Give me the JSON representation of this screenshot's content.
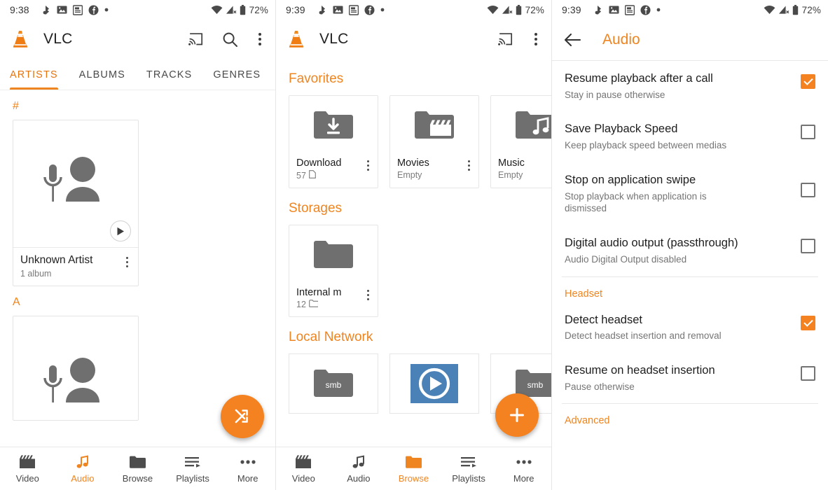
{
  "status_bar": {
    "time_panel1": "9:38",
    "time_panel2": "9:39",
    "time_panel3": "9:39",
    "battery_pct": "72%",
    "icons": [
      "bluetooth-audio-icon",
      "image-icon",
      "news-icon",
      "facebook-icon",
      "dot-icon",
      "wifi-icon",
      "cellular-off-icon",
      "battery-icon"
    ]
  },
  "panel1": {
    "app_title": "VLC",
    "actions": {
      "cast": "cast-icon",
      "search": "search-icon",
      "overflow": "overflow-menu-icon"
    },
    "tabs": [
      {
        "label": "ARTISTS",
        "active": true
      },
      {
        "label": "ALBUMS",
        "active": false
      },
      {
        "label": "TRACKS",
        "active": false
      },
      {
        "label": "GENRES",
        "active": false
      }
    ],
    "sections": [
      {
        "letter": "#"
      },
      {
        "letter": "A"
      }
    ],
    "artist_card": {
      "name": "Unknown Artist",
      "subtitle": "1 album"
    },
    "fab": "shuffle-icon",
    "bottom_nav": [
      {
        "label": "Video",
        "icon": "movie-clapper-icon",
        "active": false
      },
      {
        "label": "Audio",
        "icon": "music-note-icon",
        "active": true
      },
      {
        "label": "Browse",
        "icon": "folder-icon",
        "active": false
      },
      {
        "label": "Playlists",
        "icon": "playlist-icon",
        "active": false
      },
      {
        "label": "More",
        "icon": "more-dots-icon",
        "active": false
      }
    ]
  },
  "panel2": {
    "app_title": "VLC",
    "actions": {
      "cast": "cast-icon",
      "overflow": "overflow-menu-icon"
    },
    "sections": [
      {
        "title": "Favorites",
        "items": [
          {
            "name": "Download",
            "subtitle": "57",
            "sub_icon": "file-icon",
            "icon": "folder-download-icon"
          },
          {
            "name": "Movies",
            "subtitle": "Empty",
            "sub_icon": "",
            "icon": "folder-movie-icon"
          },
          {
            "name": "Music",
            "subtitle": "Empty",
            "sub_icon": "",
            "icon": "folder-music-icon"
          }
        ]
      },
      {
        "title": "Storages",
        "items": [
          {
            "name": "Internal m",
            "subtitle": "12",
            "sub_icon": "folder-outline-icon",
            "icon": "folder-icon"
          }
        ]
      },
      {
        "title": "Local Network",
        "items": [
          {
            "name": "smb",
            "icon": "folder-smb-icon"
          },
          {
            "name": "",
            "icon": "vlc-media-icon"
          },
          {
            "name": "smb",
            "icon": "folder-smb-icon"
          }
        ]
      }
    ],
    "fab": "add-icon",
    "bottom_nav": [
      {
        "label": "Video",
        "icon": "movie-clapper-icon",
        "active": false
      },
      {
        "label": "Audio",
        "icon": "music-note-icon",
        "active": false
      },
      {
        "label": "Browse",
        "icon": "folder-icon",
        "active": true
      },
      {
        "label": "Playlists",
        "icon": "playlist-icon",
        "active": false
      },
      {
        "label": "More",
        "icon": "more-dots-icon",
        "active": false
      }
    ]
  },
  "panel3": {
    "back": "back-arrow-icon",
    "title": "Audio",
    "preferences": [
      {
        "title": "Resume playback after a call",
        "summary": "Stay in pause otherwise",
        "checked": true
      },
      {
        "title": "Save Playback Speed",
        "summary": "Keep playback speed between medias",
        "checked": false
      },
      {
        "title": "Stop on application swipe",
        "summary": "Stop playback when application is dismissed",
        "checked": false
      },
      {
        "title": "Digital audio output (passthrough)",
        "summary": "Audio Digital Output disabled",
        "checked": false
      }
    ],
    "headset_category": "Headset",
    "headset_preferences": [
      {
        "title": "Detect headset",
        "summary": "Detect headset insertion and removal",
        "checked": true
      },
      {
        "title": "Resume on headset insertion",
        "summary": "Pause otherwise",
        "checked": false
      }
    ],
    "advanced_category": "Advanced"
  },
  "colors": {
    "accent": "#ef8521",
    "fab": "#f58220",
    "text_primary": "#1d1d1d",
    "text_secondary": "#757575"
  }
}
